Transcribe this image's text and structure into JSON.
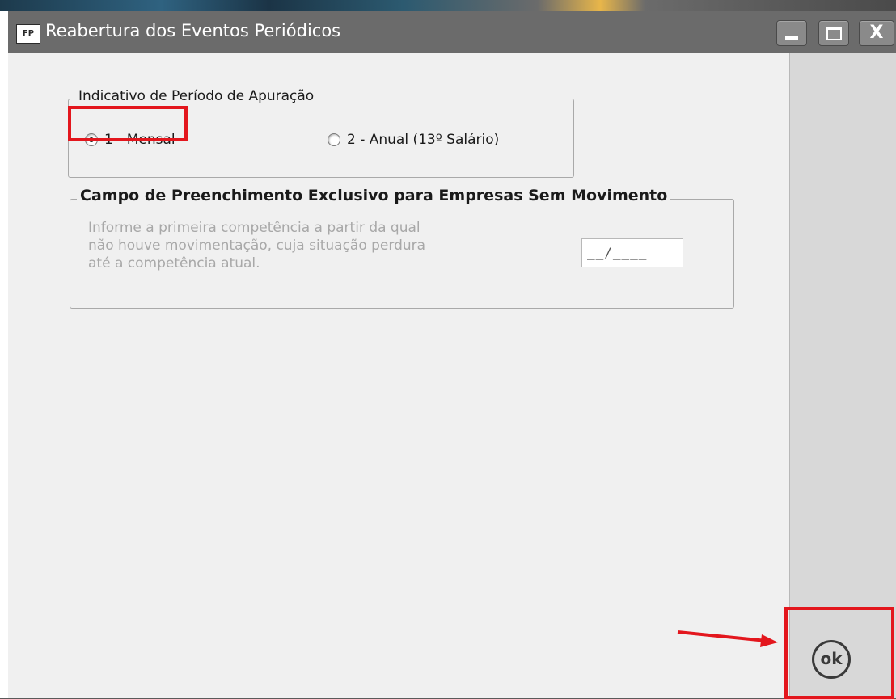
{
  "window": {
    "app_icon_text": "FP",
    "title": "Reabertura dos Eventos Periódicos",
    "minimize_icon": "minimize-icon",
    "maximize_icon": "maximize-icon",
    "close_icon": "close-icon",
    "close_glyph": "X"
  },
  "periodo": {
    "legend": "Indicativo de Período de Apuração",
    "options": [
      {
        "label": "1 - Mensal",
        "checked": true
      },
      {
        "label": "2 - Anual (13º Salário)",
        "checked": false
      }
    ]
  },
  "sem_movimento": {
    "legend": "Campo de Preenchimento Exclusivo para Empresas Sem Movimento",
    "info_lines": [
      "Informe a primeira competência a partir da qual",
      "não houve movimentação, cuja situação perdura",
      "até a competência atual."
    ],
    "competencia_value": "__/____"
  },
  "actions": {
    "ok_label": "ok"
  },
  "colors": {
    "highlight": "#e3161d",
    "content_bg": "#f0f0f0",
    "titlebar_bg": "#6b6b6b"
  }
}
